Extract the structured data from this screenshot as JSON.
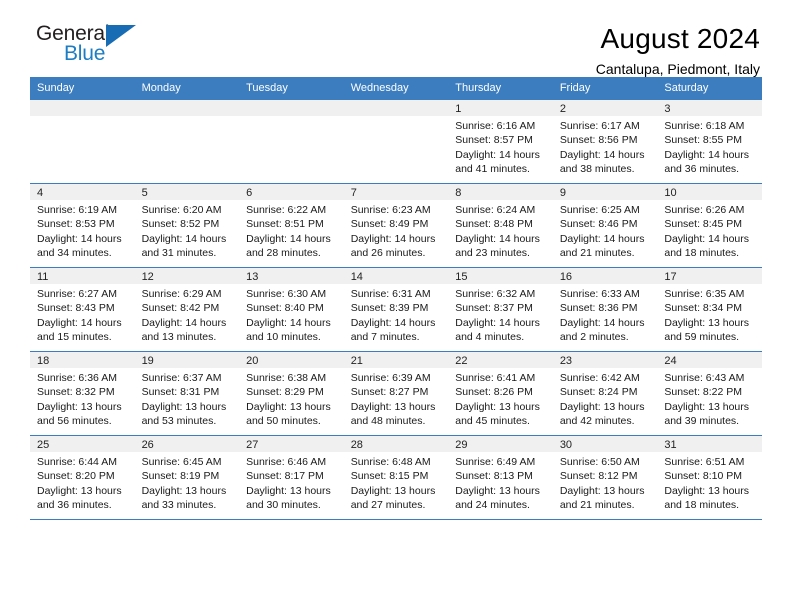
{
  "logo": {
    "line1": "General",
    "line2": "Blue",
    "triangle_color": "#176cb4",
    "blue_text_color": "#1d7dc4"
  },
  "header": {
    "title": "August 2024",
    "location": "Cantalupa, Piedmont, Italy"
  },
  "theme": {
    "header_row_bg": "#3c7dbf",
    "daynum_bg": "#f0f0f0",
    "grid_line": "#3c7dbf"
  },
  "weekday_headers": [
    "Sunday",
    "Monday",
    "Tuesday",
    "Wednesday",
    "Thursday",
    "Friday",
    "Saturday"
  ],
  "weeks": [
    [
      {
        "day": "",
        "empty": true
      },
      {
        "day": "",
        "empty": true
      },
      {
        "day": "",
        "empty": true
      },
      {
        "day": "",
        "empty": true
      },
      {
        "day": "1",
        "sunrise": "Sunrise: 6:16 AM",
        "sunset": "Sunset: 8:57 PM",
        "daylight1": "Daylight: 14 hours",
        "daylight2": "and 41 minutes."
      },
      {
        "day": "2",
        "sunrise": "Sunrise: 6:17 AM",
        "sunset": "Sunset: 8:56 PM",
        "daylight1": "Daylight: 14 hours",
        "daylight2": "and 38 minutes."
      },
      {
        "day": "3",
        "sunrise": "Sunrise: 6:18 AM",
        "sunset": "Sunset: 8:55 PM",
        "daylight1": "Daylight: 14 hours",
        "daylight2": "and 36 minutes."
      }
    ],
    [
      {
        "day": "4",
        "sunrise": "Sunrise: 6:19 AM",
        "sunset": "Sunset: 8:53 PM",
        "daylight1": "Daylight: 14 hours",
        "daylight2": "and 34 minutes."
      },
      {
        "day": "5",
        "sunrise": "Sunrise: 6:20 AM",
        "sunset": "Sunset: 8:52 PM",
        "daylight1": "Daylight: 14 hours",
        "daylight2": "and 31 minutes."
      },
      {
        "day": "6",
        "sunrise": "Sunrise: 6:22 AM",
        "sunset": "Sunset: 8:51 PM",
        "daylight1": "Daylight: 14 hours",
        "daylight2": "and 28 minutes."
      },
      {
        "day": "7",
        "sunrise": "Sunrise: 6:23 AM",
        "sunset": "Sunset: 8:49 PM",
        "daylight1": "Daylight: 14 hours",
        "daylight2": "and 26 minutes."
      },
      {
        "day": "8",
        "sunrise": "Sunrise: 6:24 AM",
        "sunset": "Sunset: 8:48 PM",
        "daylight1": "Daylight: 14 hours",
        "daylight2": "and 23 minutes."
      },
      {
        "day": "9",
        "sunrise": "Sunrise: 6:25 AM",
        "sunset": "Sunset: 8:46 PM",
        "daylight1": "Daylight: 14 hours",
        "daylight2": "and 21 minutes."
      },
      {
        "day": "10",
        "sunrise": "Sunrise: 6:26 AM",
        "sunset": "Sunset: 8:45 PM",
        "daylight1": "Daylight: 14 hours",
        "daylight2": "and 18 minutes."
      }
    ],
    [
      {
        "day": "11",
        "sunrise": "Sunrise: 6:27 AM",
        "sunset": "Sunset: 8:43 PM",
        "daylight1": "Daylight: 14 hours",
        "daylight2": "and 15 minutes."
      },
      {
        "day": "12",
        "sunrise": "Sunrise: 6:29 AM",
        "sunset": "Sunset: 8:42 PM",
        "daylight1": "Daylight: 14 hours",
        "daylight2": "and 13 minutes."
      },
      {
        "day": "13",
        "sunrise": "Sunrise: 6:30 AM",
        "sunset": "Sunset: 8:40 PM",
        "daylight1": "Daylight: 14 hours",
        "daylight2": "and 10 minutes."
      },
      {
        "day": "14",
        "sunrise": "Sunrise: 6:31 AM",
        "sunset": "Sunset: 8:39 PM",
        "daylight1": "Daylight: 14 hours",
        "daylight2": "and 7 minutes."
      },
      {
        "day": "15",
        "sunrise": "Sunrise: 6:32 AM",
        "sunset": "Sunset: 8:37 PM",
        "daylight1": "Daylight: 14 hours",
        "daylight2": "and 4 minutes."
      },
      {
        "day": "16",
        "sunrise": "Sunrise: 6:33 AM",
        "sunset": "Sunset: 8:36 PM",
        "daylight1": "Daylight: 14 hours",
        "daylight2": "and 2 minutes."
      },
      {
        "day": "17",
        "sunrise": "Sunrise: 6:35 AM",
        "sunset": "Sunset: 8:34 PM",
        "daylight1": "Daylight: 13 hours",
        "daylight2": "and 59 minutes."
      }
    ],
    [
      {
        "day": "18",
        "sunrise": "Sunrise: 6:36 AM",
        "sunset": "Sunset: 8:32 PM",
        "daylight1": "Daylight: 13 hours",
        "daylight2": "and 56 minutes."
      },
      {
        "day": "19",
        "sunrise": "Sunrise: 6:37 AM",
        "sunset": "Sunset: 8:31 PM",
        "daylight1": "Daylight: 13 hours",
        "daylight2": "and 53 minutes."
      },
      {
        "day": "20",
        "sunrise": "Sunrise: 6:38 AM",
        "sunset": "Sunset: 8:29 PM",
        "daylight1": "Daylight: 13 hours",
        "daylight2": "and 50 minutes."
      },
      {
        "day": "21",
        "sunrise": "Sunrise: 6:39 AM",
        "sunset": "Sunset: 8:27 PM",
        "daylight1": "Daylight: 13 hours",
        "daylight2": "and 48 minutes."
      },
      {
        "day": "22",
        "sunrise": "Sunrise: 6:41 AM",
        "sunset": "Sunset: 8:26 PM",
        "daylight1": "Daylight: 13 hours",
        "daylight2": "and 45 minutes."
      },
      {
        "day": "23",
        "sunrise": "Sunrise: 6:42 AM",
        "sunset": "Sunset: 8:24 PM",
        "daylight1": "Daylight: 13 hours",
        "daylight2": "and 42 minutes."
      },
      {
        "day": "24",
        "sunrise": "Sunrise: 6:43 AM",
        "sunset": "Sunset: 8:22 PM",
        "daylight1": "Daylight: 13 hours",
        "daylight2": "and 39 minutes."
      }
    ],
    [
      {
        "day": "25",
        "sunrise": "Sunrise: 6:44 AM",
        "sunset": "Sunset: 8:20 PM",
        "daylight1": "Daylight: 13 hours",
        "daylight2": "and 36 minutes."
      },
      {
        "day": "26",
        "sunrise": "Sunrise: 6:45 AM",
        "sunset": "Sunset: 8:19 PM",
        "daylight1": "Daylight: 13 hours",
        "daylight2": "and 33 minutes."
      },
      {
        "day": "27",
        "sunrise": "Sunrise: 6:46 AM",
        "sunset": "Sunset: 8:17 PM",
        "daylight1": "Daylight: 13 hours",
        "daylight2": "and 30 minutes."
      },
      {
        "day": "28",
        "sunrise": "Sunrise: 6:48 AM",
        "sunset": "Sunset: 8:15 PM",
        "daylight1": "Daylight: 13 hours",
        "daylight2": "and 27 minutes."
      },
      {
        "day": "29",
        "sunrise": "Sunrise: 6:49 AM",
        "sunset": "Sunset: 8:13 PM",
        "daylight1": "Daylight: 13 hours",
        "daylight2": "and 24 minutes."
      },
      {
        "day": "30",
        "sunrise": "Sunrise: 6:50 AM",
        "sunset": "Sunset: 8:12 PM",
        "daylight1": "Daylight: 13 hours",
        "daylight2": "and 21 minutes."
      },
      {
        "day": "31",
        "sunrise": "Sunrise: 6:51 AM",
        "sunset": "Sunset: 8:10 PM",
        "daylight1": "Daylight: 13 hours",
        "daylight2": "and 18 minutes."
      }
    ]
  ]
}
